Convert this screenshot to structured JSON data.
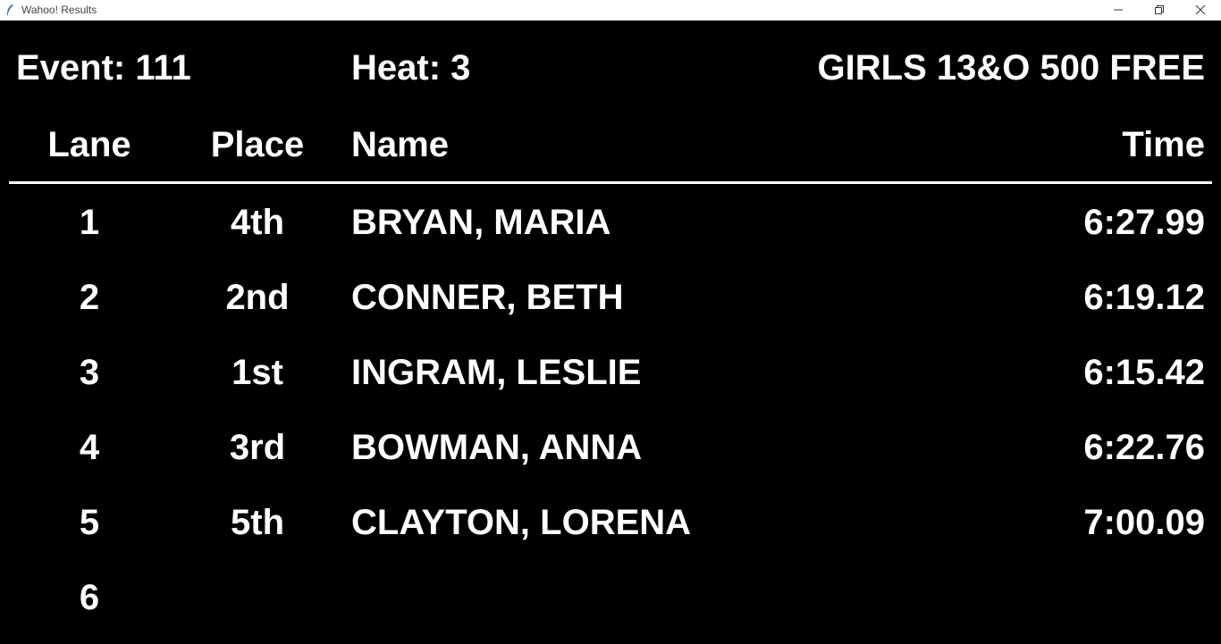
{
  "window": {
    "title": "Wahoo! Results",
    "icons": {
      "app": "feather-icon",
      "minimize": "minimize-icon",
      "restore": "restore-icon",
      "close": "close-icon"
    }
  },
  "event": {
    "label": "Event: 111"
  },
  "heat": {
    "label": "Heat: 3"
  },
  "race": {
    "title": "GIRLS 13&O 500 FREE"
  },
  "columns": {
    "lane": "Lane",
    "place": "Place",
    "name": "Name",
    "time": "Time"
  },
  "rows": [
    {
      "lane": "1",
      "place": "4th",
      "name": "BRYAN, MARIA",
      "time": "6:27.99"
    },
    {
      "lane": "2",
      "place": "2nd",
      "name": "CONNER, BETH",
      "time": "6:19.12"
    },
    {
      "lane": "3",
      "place": "1st",
      "name": "INGRAM, LESLIE",
      "time": "6:15.42"
    },
    {
      "lane": "4",
      "place": "3rd",
      "name": "BOWMAN, ANNA",
      "time": "6:22.76"
    },
    {
      "lane": "5",
      "place": "5th",
      "name": "CLAYTON, LORENA",
      "time": "7:00.09"
    },
    {
      "lane": "6",
      "place": "",
      "name": "",
      "time": ""
    }
  ],
  "colors": {
    "background": "#000000",
    "text": "#ffffff"
  }
}
